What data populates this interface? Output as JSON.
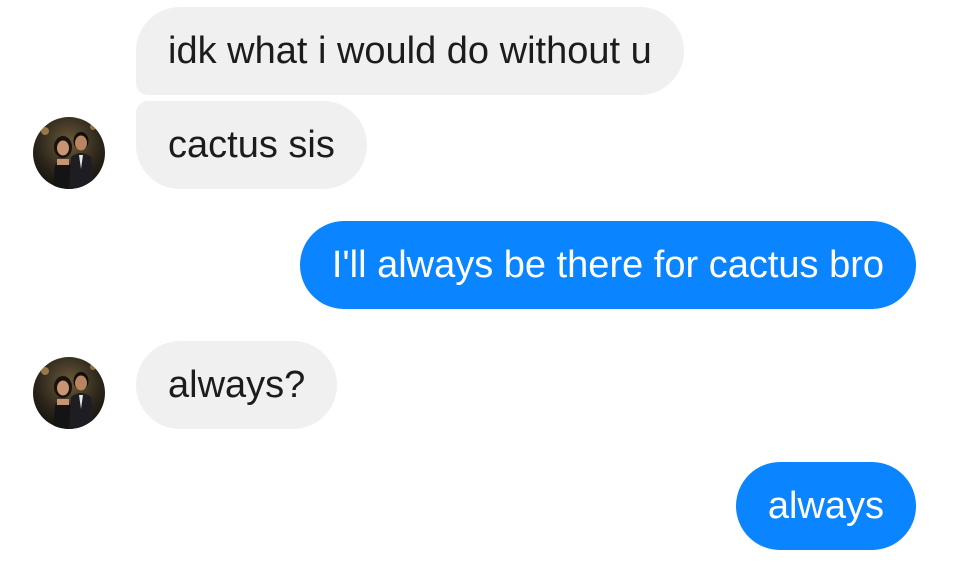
{
  "conversation": {
    "messages": [
      {
        "sender": "contact",
        "text": "idk what i would do without u"
      },
      {
        "sender": "contact",
        "text": "cactus sis"
      },
      {
        "sender": "me",
        "text": "I'll always be there for cactus bro"
      },
      {
        "sender": "contact",
        "text": "always?"
      },
      {
        "sender": "me",
        "text": "always"
      }
    ],
    "colors": {
      "incoming_bubble": "#f0f0f0",
      "incoming_text": "#1c1c1c",
      "outgoing_bubble": "#0a84ff",
      "outgoing_text": "#ffffff"
    },
    "contact_avatar_icon": "contact-photo-avatar"
  }
}
